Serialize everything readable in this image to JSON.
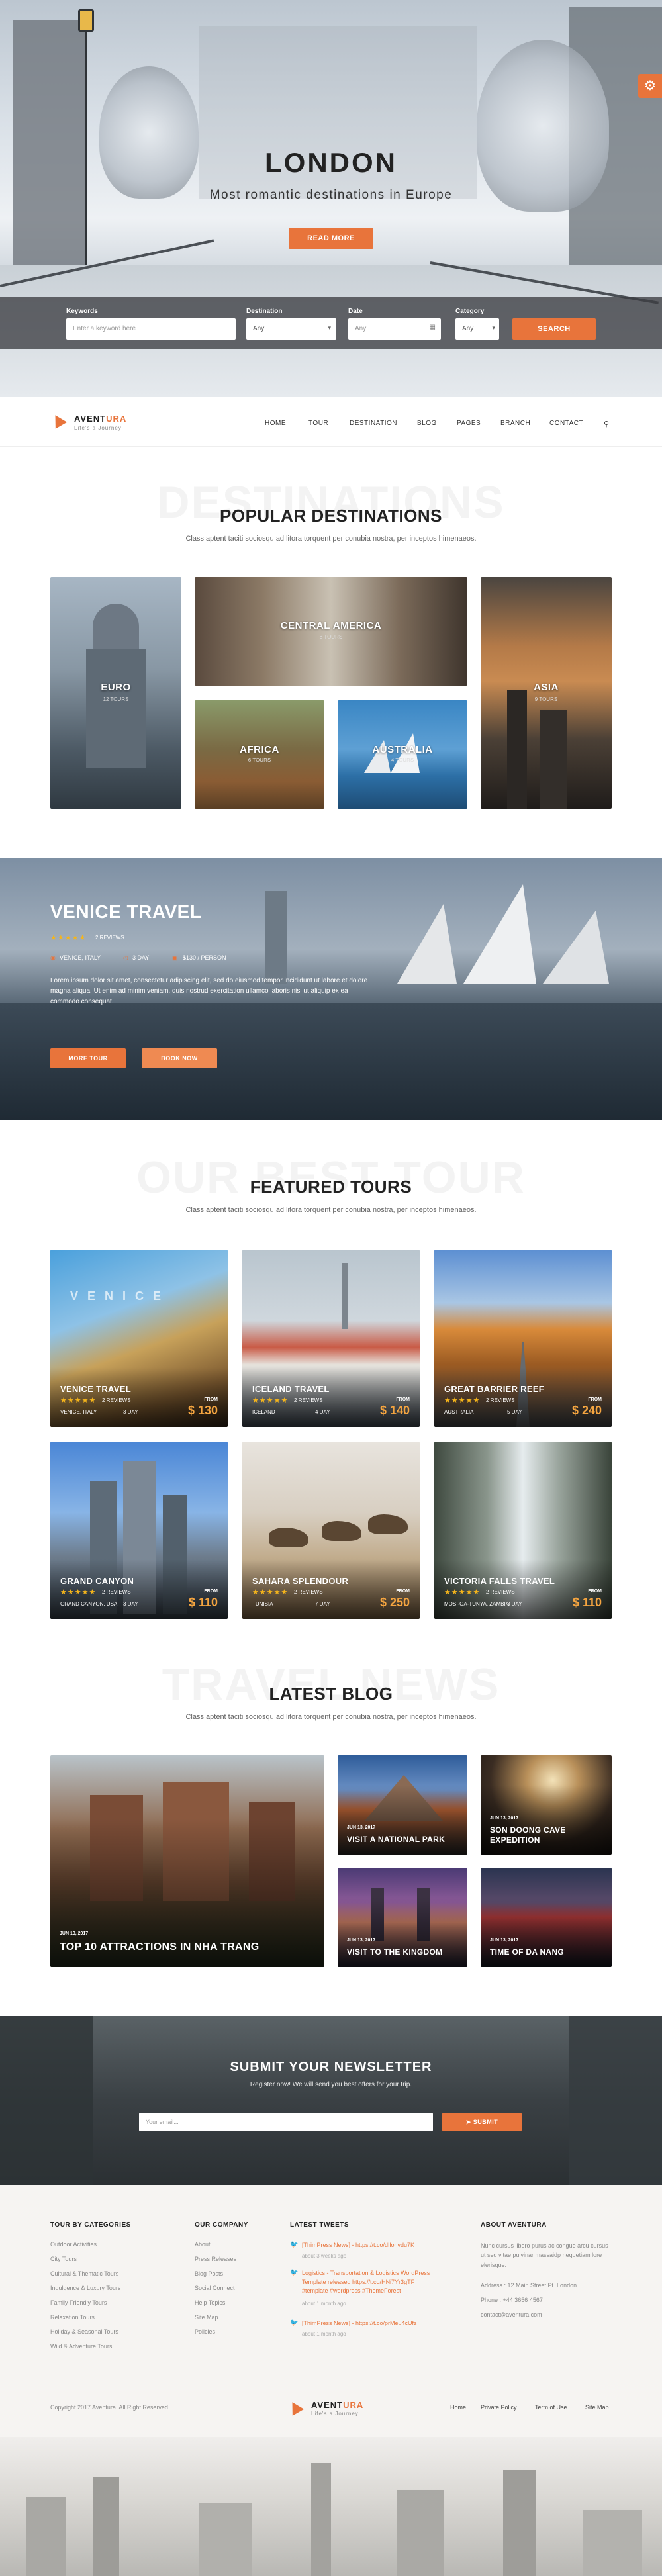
{
  "hero": {
    "title": "LONDON",
    "subtitle": "Most romantic destinations in Europe",
    "cta": "READ MORE"
  },
  "search": {
    "keywords_label": "Keywords",
    "keywords_placeholder": "Enter a keyword here",
    "destination_label": "Destination",
    "destination_value": "Any",
    "date_label": "Date",
    "date_placeholder": "Any",
    "category_label": "Category",
    "category_value": "Any",
    "submit": "SEARCH"
  },
  "nav": {
    "brand_a": "AVENT",
    "brand_b": "URA",
    "tagline": "Life's a Journey",
    "items": [
      "HOME",
      "TOUR",
      "DESTINATION",
      "BLOG",
      "PAGES",
      "BRANCH",
      "CONTACT"
    ]
  },
  "destinations": {
    "ghost": "DESTINATIONS",
    "title": "POPULAR DESTINATIONS",
    "subtitle": "Class aptent taciti sociosqu ad litora torquent per conubia nostra, per inceptos himenaeos.",
    "items": [
      {
        "name": "EURO",
        "count": "12 TOURS"
      },
      {
        "name": "CENTRAL AMERICA",
        "count": "8 TOURS"
      },
      {
        "name": "AFRICA",
        "count": "6 TOURS"
      },
      {
        "name": "AUSTRALIA",
        "count": "4 TOURS"
      },
      {
        "name": "ASIA",
        "count": "9 TOURS"
      }
    ]
  },
  "venice": {
    "title": "VENICE TRAVEL",
    "reviews": "2 REVIEWS",
    "location": "VENICE, ITALY",
    "duration": "3 DAY",
    "price": "$130 / PERSON",
    "description": "Lorem ipsum dolor sit amet, consectetur adipiscing elit, sed do eiusmod tempor incididunt ut labore et dolore magna aliqua. Ut enim ad minim veniam, quis nostrud exercitation ullamco laboris nisi ut aliquip ex ea commodo consequat.",
    "more_btn": "MORE TOUR",
    "book_btn": "BOOK NOW"
  },
  "featured": {
    "ghost": "OUR BEST TOUR",
    "title": "FEATURED TOURS",
    "subtitle": "Class aptent taciti sociosqu ad litora torquent per conubia nostra, per inceptos himenaeos.",
    "from_label": "FROM",
    "tours": [
      {
        "name": "VENICE TRAVEL",
        "reviews": "2 REVIEWS",
        "location": "VENICE, ITALY",
        "days": "3 DAY",
        "price": "$ 130"
      },
      {
        "name": "ICELAND TRAVEL",
        "reviews": "2 REVIEWS",
        "location": "ICELAND",
        "days": "4 DAY",
        "price": "$ 140"
      },
      {
        "name": "GREAT BARRIER REEF",
        "reviews": "2 REVIEWS",
        "location": "AUSTRALIA",
        "days": "5 DAY",
        "price": "$ 240"
      },
      {
        "name": "GRAND CANYON",
        "reviews": "2 REVIEWS",
        "location": "GRAND CANYON, USA",
        "days": "3 DAY",
        "price": "$ 110"
      },
      {
        "name": "SAHARA SPLENDOUR",
        "reviews": "2 REVIEWS",
        "location": "TUNISIA",
        "days": "7 DAY",
        "price": "$ 250"
      },
      {
        "name": "VICTORIA FALLS TRAVEL",
        "reviews": "2 REVIEWS",
        "location": "MOSI-OA-TUNYA, ZAMBIA",
        "days": "3 DAY",
        "price": "$ 110"
      }
    ]
  },
  "blog": {
    "ghost": "TRAVEL NEWS",
    "title": "LATEST BLOG",
    "subtitle": "Class aptent taciti sociosqu ad litora torquent per conubia nostra, per inceptos himenaeos.",
    "posts": [
      {
        "date": "JUN 13, 2017",
        "title": "TOP 10 ATTRACTIONS IN NHA TRANG"
      },
      {
        "date": "JUN 13, 2017",
        "title": "VISIT A NATIONAL PARK"
      },
      {
        "date": "JUN 13, 2017",
        "title": "SON DOONG CAVE EXPEDITION"
      },
      {
        "date": "JUN 13, 2017",
        "title": "VISIT TO THE KINGDOM"
      },
      {
        "date": "JUN 13, 2017",
        "title": "TIME OF DA NANG"
      }
    ]
  },
  "newsletter": {
    "title": "SUBMIT YOUR NEWSLETTER",
    "subtitle": "Register now! We will send you best offers for your trip.",
    "placeholder": "Your email...",
    "submit": "SUBMIT"
  },
  "footer": {
    "col1_title": "TOUR BY CATEGORIES",
    "col1_links": [
      "Outdoor Activities",
      "City Tours",
      "Cultural & Thematic Tours",
      "Indulgence & Luxury Tours",
      "Family Friendly Tours",
      "Relaxation Tours",
      "Holiday & Seasonal Tours",
      "Wild & Adventure Tours"
    ],
    "col2_title": "OUR COMPANY",
    "col2_links": [
      "About",
      "Press Releases",
      "Blog Posts",
      "Social Connect",
      "Help Topics",
      "Site Map",
      "Policies"
    ],
    "col3_title": "LATEST TWEETS",
    "tweets": [
      {
        "text": "[ThimPress News] - https://t.co/dIlonvdu7K",
        "time": "about 3 weeks ago"
      },
      {
        "text": "Logistics - Transportation & Logistics WordPress Template released https://t.co/HNi7Yr3gTF #template #wordpress #ThemeForest",
        "time": "about 1 month ago"
      },
      {
        "text": "[ThimPress News] - https://t.co/prMeu4cUfz",
        "time": "about 1 month ago"
      }
    ],
    "col4_title": "ABOUT AVENTURA",
    "about_text": "Nunc cursus libero purus ac congue arcu cursus ut sed vitae pulvinar massaidp nequetiam lore elerisque.",
    "address": "Address : 12 Main Street Pt. London",
    "phone": "Phone : +44 3656 4567",
    "email": "contact@aventura.com",
    "copyright": "Copyright 2017 Aventura. All Right Reserved",
    "bottom_links": [
      "Home",
      "Private Policy",
      "Term of Use",
      "Site Map"
    ]
  },
  "colors": {
    "accent": "#e8743b",
    "star": "#f5b51b",
    "dark": "#222222"
  }
}
